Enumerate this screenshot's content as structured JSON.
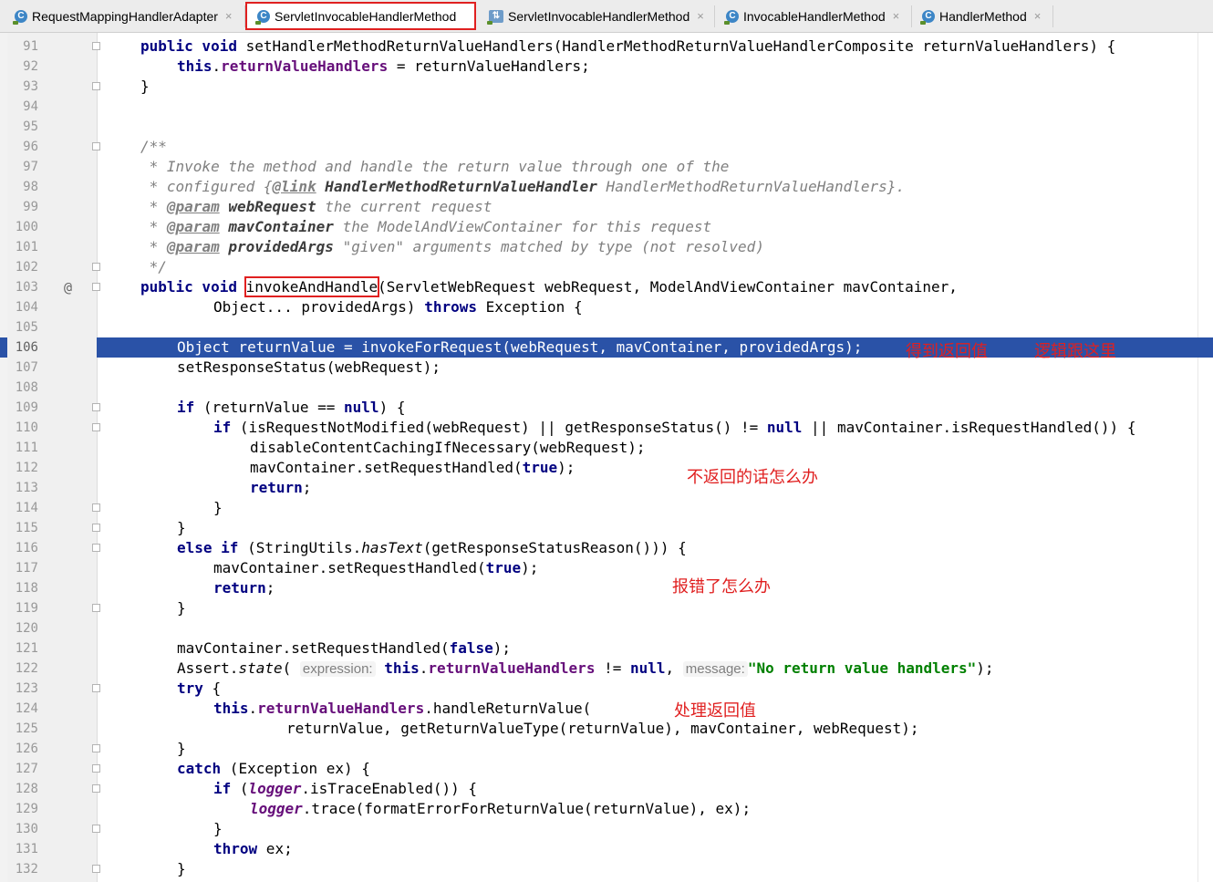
{
  "tabs": [
    {
      "label": "RequestMappingHandlerAdapter",
      "icon": "C",
      "active": false
    },
    {
      "label": "ServletInvocableHandlerMethod",
      "icon": "C",
      "active": true
    },
    {
      "label": "ServletInvocableHandlerMethod",
      "icon": "test",
      "active": false
    },
    {
      "label": "InvocableHandlerMethod",
      "icon": "C",
      "active": false
    },
    {
      "label": "HandlerMethod",
      "icon": "C",
      "active": false
    }
  ],
  "close_glyph": "×",
  "gutter_mark": "@",
  "line_numbers": [
    "91",
    "92",
    "93",
    "94",
    "95",
    "96",
    "97",
    "98",
    "99",
    "100",
    "101",
    "102",
    "103",
    "104",
    "105",
    "106",
    "107",
    "108",
    "109",
    "110",
    "111",
    "112",
    "113",
    "114",
    "115",
    "116",
    "117",
    "118",
    "119",
    "120",
    "121",
    "122",
    "123",
    "124",
    "125",
    "126",
    "127",
    "128",
    "129",
    "130",
    "131",
    "132"
  ],
  "code": {
    "l91": {
      "kw": "public void",
      "text": " setHandlerMethodReturnValueHandlers(HandlerMethodReturnValueHandlerComposite returnValueHandlers) {"
    },
    "l92": {
      "kw": "this",
      "dot": ".",
      "field": "returnValueHandlers",
      "text": " = returnValueHandlers;"
    },
    "l93": "}",
    "l96": "/**",
    "l97": " * Invoke the method and handle the return value through one of the",
    "l98": {
      "pre": " * configured {",
      "tag": "@link",
      "bold": " HandlerMethodReturnValueHandler",
      "post": " HandlerMethodReturnValueHandlers}."
    },
    "l99": {
      "pre": " * ",
      "tag": "@param",
      "bold": " webRequest",
      "post": " the current request"
    },
    "l100": {
      "pre": " * ",
      "tag": "@param",
      "bold": " mavContainer",
      "post": " the ModelAndViewContainer for this request"
    },
    "l101": {
      "pre": " * ",
      "tag": "@param",
      "bold": " providedArgs",
      "post": " \"given\" arguments matched by type (not resolved)"
    },
    "l102": " */",
    "l103": {
      "kw": "public void",
      "method": "invokeAndHandle",
      "text": "(ServletWebRequest webRequest, ModelAndViewContainer mavContainer,"
    },
    "l104": {
      "text1": "Object... providedArgs) ",
      "kw": "throws",
      "text2": " Exception {"
    },
    "l106": "Object returnValue = invokeForRequest(webRequest, mavContainer, providedArgs);",
    "l107": "setResponseStatus(webRequest);",
    "l109": {
      "kw": "if",
      "text": " (returnValue == ",
      "kw2": "null",
      "text2": ") {"
    },
    "l110": {
      "kw": "if",
      "text": " (isRequestNotModified(webRequest) || getResponseStatus() != ",
      "kw2": "null",
      "text2": " || mavContainer.isRequestHandled()) {"
    },
    "l111": "disableContentCachingIfNecessary(webRequest);",
    "l112": {
      "text": "mavContainer.setRequestHandled(",
      "kw": "true",
      "text2": ");"
    },
    "l113": {
      "kw": "return",
      "text": ";"
    },
    "l114": "}",
    "l115": "}",
    "l116": {
      "kw": "else if",
      "text": " (StringUtils.",
      "italic": "hasText",
      "text2": "(getResponseStatusReason())) {"
    },
    "l117": {
      "text": "mavContainer.setRequestHandled(",
      "kw": "true",
      "text2": ");"
    },
    "l118": {
      "kw": "return",
      "text": ";"
    },
    "l119": "}",
    "l121": {
      "text": "mavContainer.setRequestHandled(",
      "kw": "false",
      "text2": ");"
    },
    "l122": {
      "text": "Assert.",
      "italic": "state",
      "text2": "(",
      "hint1": "expression:",
      "kw": "this",
      "dot": ".",
      "field": "returnValueHandlers",
      "text3": " != ",
      "kw2": "null",
      "text4": ", ",
      "hint2": "message:",
      "str": "\"No return value handlers\"",
      "text5": ");"
    },
    "l123": {
      "kw": "try",
      "text": " {"
    },
    "l124": {
      "kw": "this",
      "dot": ".",
      "field": "returnValueHandlers",
      "text": ".handleReturnValue("
    },
    "l125": "returnValue, getReturnValueType(returnValue), mavContainer, webRequest);",
    "l126": "}",
    "l127": {
      "kw": "catch",
      "text": " (Exception ex) {"
    },
    "l128": {
      "kw": "if",
      "text": " (",
      "field": "logger",
      "text2": ".isTraceEnabled()) {"
    },
    "l129": {
      "field": "logger",
      "text": ".trace(formatErrorForReturnValue(returnValue), ex);"
    },
    "l130": "}",
    "l131": {
      "kw": "throw",
      "text": " ex;"
    },
    "l132": "}"
  },
  "annotations": {
    "get_return_value": "得到返回值",
    "logic_follow": "逻辑跟这里",
    "no_return": "不返回的话怎么办",
    "error": "报错了怎么办",
    "handle_return": "处理返回值"
  },
  "colors": {
    "keyword": "#000080",
    "field": "#660e7a",
    "comment": "#808080",
    "string": "#008000",
    "selection": "#2a52a7",
    "annotation": "#e02020"
  }
}
